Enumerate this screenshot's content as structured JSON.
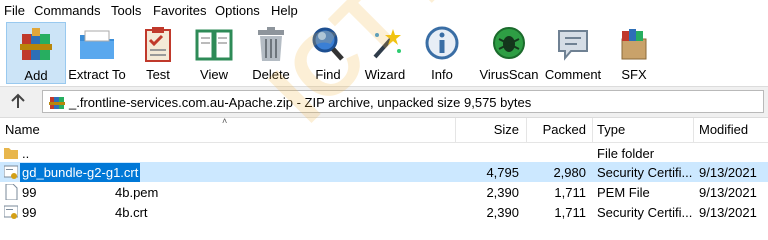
{
  "menu": [
    "File",
    "Commands",
    "Tools",
    "Favorites",
    "Options",
    "Help"
  ],
  "toolbar": [
    {
      "label": "Add",
      "icon": "add-archive-icon"
    },
    {
      "label": "Extract To",
      "icon": "extract-folder-icon"
    },
    {
      "label": "Test",
      "icon": "test-clipboard-icon"
    },
    {
      "label": "View",
      "icon": "view-book-icon"
    },
    {
      "label": "Delete",
      "icon": "trash-can-icon"
    },
    {
      "label": "Find",
      "icon": "magnifier-icon"
    },
    {
      "label": "Wizard",
      "icon": "magic-wand-icon"
    },
    {
      "label": "Info",
      "icon": "info-icon"
    },
    {
      "label": "VirusScan",
      "icon": "virus-scan-icon"
    },
    {
      "label": "Comment",
      "icon": "comment-icon"
    },
    {
      "label": "SFX",
      "icon": "sfx-box-icon"
    }
  ],
  "address": {
    "text": "_.frontline-services.com.au-Apache.zip - ZIP archive, unpacked size 9,575 bytes"
  },
  "columns": {
    "name": "Name",
    "size": "Size",
    "packed": "Packed",
    "type": "Type",
    "modified": "Modified"
  },
  "rows": [
    {
      "name": "..",
      "size": "",
      "packed": "",
      "type": "File folder",
      "modified": "",
      "icon": "folder-icon"
    },
    {
      "name": "gd_bundle-g2-g1.crt",
      "size": "4,795",
      "packed": "2,980",
      "type": "Security Certifi...",
      "modified": "9/13/2021",
      "icon": "certificate-icon",
      "selected": true
    },
    {
      "name": "99",
      "name_tail": "4b.pem",
      "size": "2,390",
      "packed": "1,711",
      "type": "PEM File",
      "modified": "9/13/2021",
      "icon": "file-icon"
    },
    {
      "name": "99",
      "name_tail": "4b.crt",
      "size": "2,390",
      "packed": "1,711",
      "type": "Security Certifi...",
      "modified": "9/13/2021",
      "icon": "certificate-icon"
    }
  ],
  "watermark": "ICT Fella",
  "colors": {
    "selection": "#cce8ff",
    "selection_text_bg": "#0078d7",
    "add_button": "#cce4f7"
  }
}
